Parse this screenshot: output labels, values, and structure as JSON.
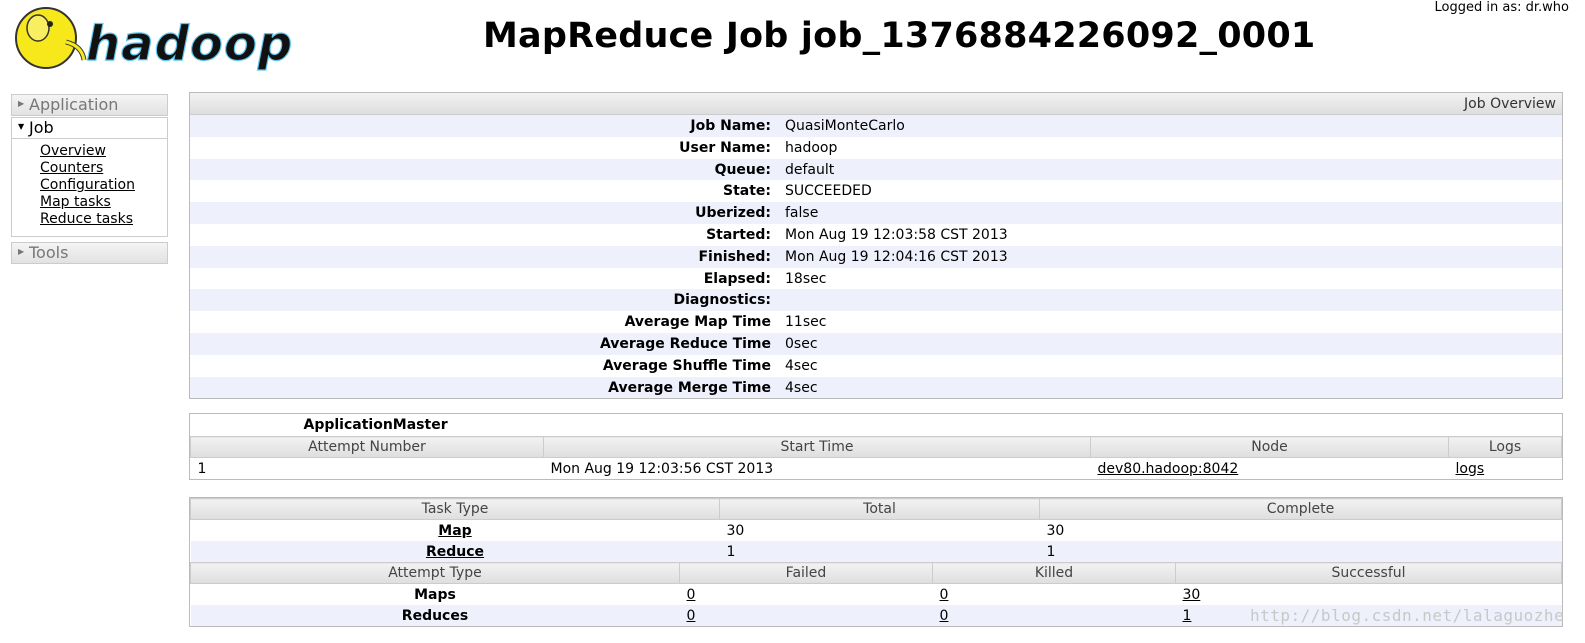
{
  "header": {
    "logo_text": "hadoop",
    "title": "MapReduce Job job_1376884226092_0001",
    "logged_in": "Logged in as: dr.who"
  },
  "sidebar": {
    "application": "Application",
    "job": "Job",
    "job_links": [
      "Overview",
      "Counters",
      "Configuration",
      "Map tasks",
      "Reduce tasks"
    ],
    "tools": "Tools"
  },
  "overview": {
    "heading": "Job Overview",
    "rows": [
      {
        "key": "Job Name:",
        "value": "QuasiMonteCarlo"
      },
      {
        "key": "User Name:",
        "value": "hadoop"
      },
      {
        "key": "Queue:",
        "value": "default"
      },
      {
        "key": "State:",
        "value": "SUCCEEDED"
      },
      {
        "key": "Uberized:",
        "value": "false"
      },
      {
        "key": "Started:",
        "value": "Mon Aug 19 12:03:58 CST 2013"
      },
      {
        "key": "Finished:",
        "value": "Mon Aug 19 12:04:16 CST 2013"
      },
      {
        "key": "Elapsed:",
        "value": "18sec"
      },
      {
        "key": "Diagnostics:",
        "value": ""
      },
      {
        "key": "Average Map Time",
        "value": "11sec"
      },
      {
        "key": "Average Reduce Time",
        "value": "0sec"
      },
      {
        "key": "Average Shuffle Time",
        "value": "4sec"
      },
      {
        "key": "Average Merge Time",
        "value": "4sec"
      }
    ]
  },
  "app_master": {
    "title": "ApplicationMaster",
    "headers": [
      "Attempt Number",
      "Start Time",
      "Node",
      "Logs"
    ],
    "row": {
      "attempt": "1",
      "start": "Mon Aug 19 12:03:56 CST 2013",
      "node": "dev80.hadoop:8042",
      "logs": "logs"
    }
  },
  "tasks": {
    "headers": [
      "Task Type",
      "Total",
      "Complete"
    ],
    "rows": [
      {
        "type": "Map",
        "total": "30",
        "complete": "30"
      },
      {
        "type": "Reduce",
        "total": "1",
        "complete": "1"
      }
    ]
  },
  "attempts": {
    "headers": [
      "Attempt Type",
      "Failed",
      "Killed",
      "Successful"
    ],
    "rows": [
      {
        "type": "Maps",
        "failed": "0",
        "killed": "0",
        "successful": "30"
      },
      {
        "type": "Reduces",
        "failed": "0",
        "killed": "0",
        "successful": "1"
      }
    ]
  },
  "watermark": "http://blog.csdn.net/lalaguozhe"
}
